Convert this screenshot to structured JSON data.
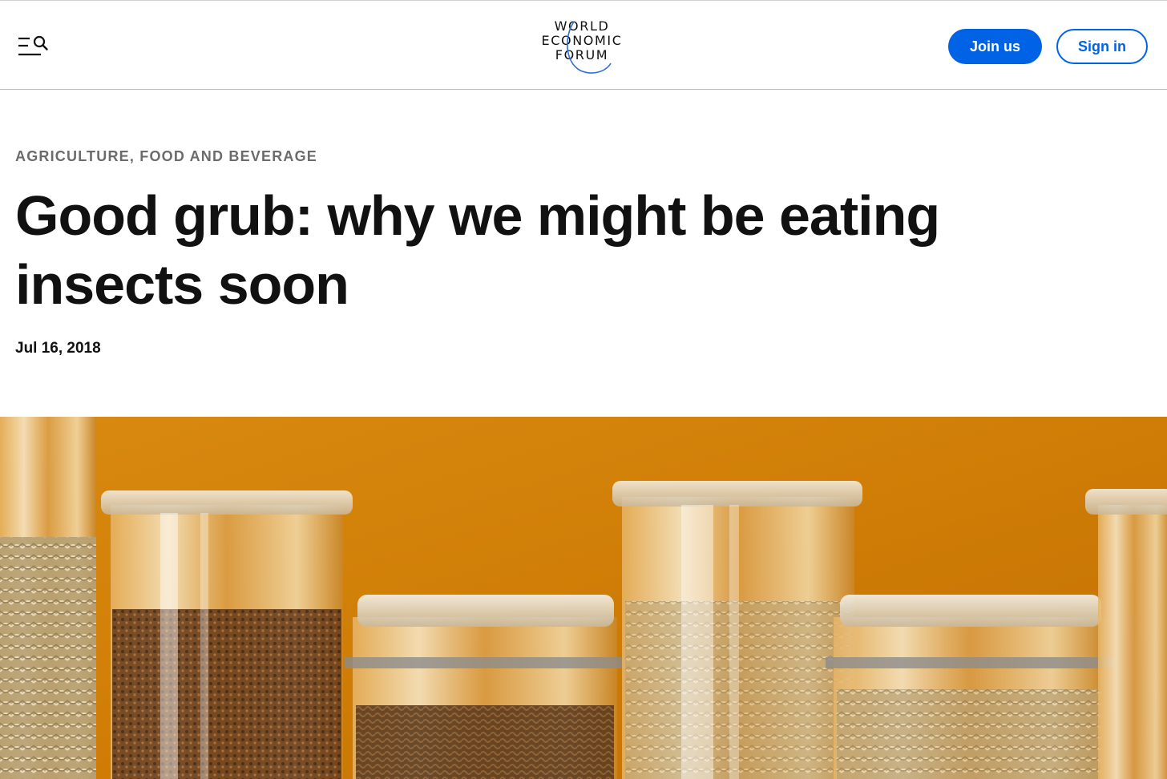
{
  "header": {
    "menu_search_icon": "menu-search-icon",
    "logo": {
      "line1": "WORLD",
      "line2": "ECONOMIC",
      "line3": "FORUM"
    },
    "join_label": "Join us",
    "sign_in_label": "Sign in",
    "accent_color": "#0062e5"
  },
  "article": {
    "category": "AGRICULTURE, FOOD AND BEVERAGE",
    "title": "Good grub: why we might be eating insects soon",
    "date": "Jul 16, 2018",
    "hero_image": "glass jars of dried insects on an orange background"
  }
}
